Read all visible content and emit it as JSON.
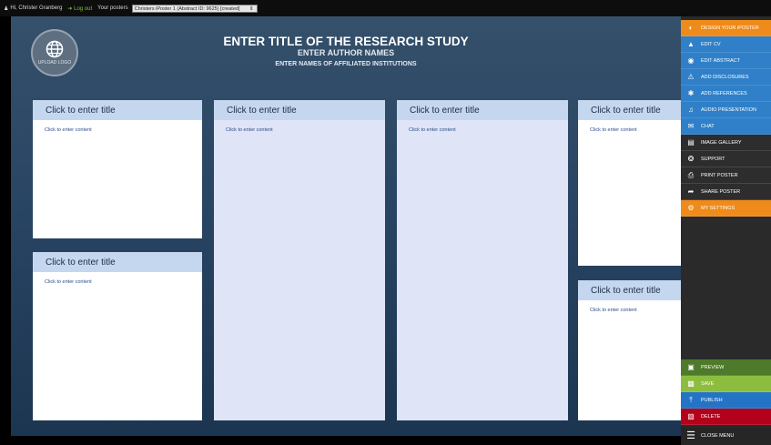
{
  "topbar": {
    "greeting": "Hi, Christer Granberg",
    "logout": "Log out",
    "posters_label": "Your posters",
    "selected_poster": "Christers iPoster 1 (Abstract ID: 9625) [created]"
  },
  "poster": {
    "logo_label": "UPLOAD LOGO",
    "title": "ENTER TITLE OF THE RESEARCH STUDY",
    "authors": "ENTER AUTHOR NAMES",
    "institutions": "ENTER NAMES OF AFFILIATED INSTITUTIONS"
  },
  "panels": [
    {
      "title": "Click to enter title",
      "content": "Click to enter content"
    },
    {
      "title": "Click to enter title",
      "content": "Click to enter content"
    },
    {
      "title": "Click to enter title",
      "content": "Click to enter content"
    },
    {
      "title": "Click to enter title",
      "content": "Click to enter content"
    },
    {
      "title": "Click to enter title",
      "content": "Click to enter content"
    },
    {
      "title": "Click to enter title",
      "content": "Click to enter content"
    }
  ],
  "menu": {
    "top": [
      {
        "label": "DESIGN YOUR iPOSTER",
        "icon": "design-icon"
      },
      {
        "label": "EDIT CV",
        "icon": "graduation-cap-icon"
      },
      {
        "label": "EDIT ABSTRACT",
        "icon": "eye-icon"
      },
      {
        "label": "ADD DISCLOSURES",
        "icon": "warning-icon"
      },
      {
        "label": "ADD REFERENCES",
        "icon": "asterisk-icon"
      },
      {
        "label": "AUDIO PRESENTATION",
        "icon": "audio-file-icon"
      },
      {
        "label": "CHAT",
        "icon": "chat-icon"
      },
      {
        "label": "IMAGE GALLERY",
        "icon": "image-icon"
      },
      {
        "label": "SUPPORT",
        "icon": "lifebuoy-icon"
      },
      {
        "label": "PRINT POSTER",
        "icon": "printer-icon"
      },
      {
        "label": "SHARE POSTER",
        "icon": "share-icon"
      },
      {
        "label": "MY SETTINGS",
        "icon": "gear-icon"
      }
    ],
    "bottom": [
      {
        "label": "PREVIEW",
        "icon": "monitor-icon"
      },
      {
        "label": "SAVE",
        "icon": "floppy-icon"
      },
      {
        "label": "PUBLISH",
        "icon": "upload-icon"
      },
      {
        "label": "DELETE",
        "icon": "trash-icon"
      }
    ],
    "close": {
      "label": "CLOSE MENU",
      "icon": "hamburger-icon"
    }
  },
  "colors": {
    "design": "#ef8b1a",
    "menu_blue": "#2f80c8",
    "preview": "#4e7a2b",
    "save": "#8dbd3f",
    "publish": "#2474c6",
    "delete": "#b3001b"
  }
}
